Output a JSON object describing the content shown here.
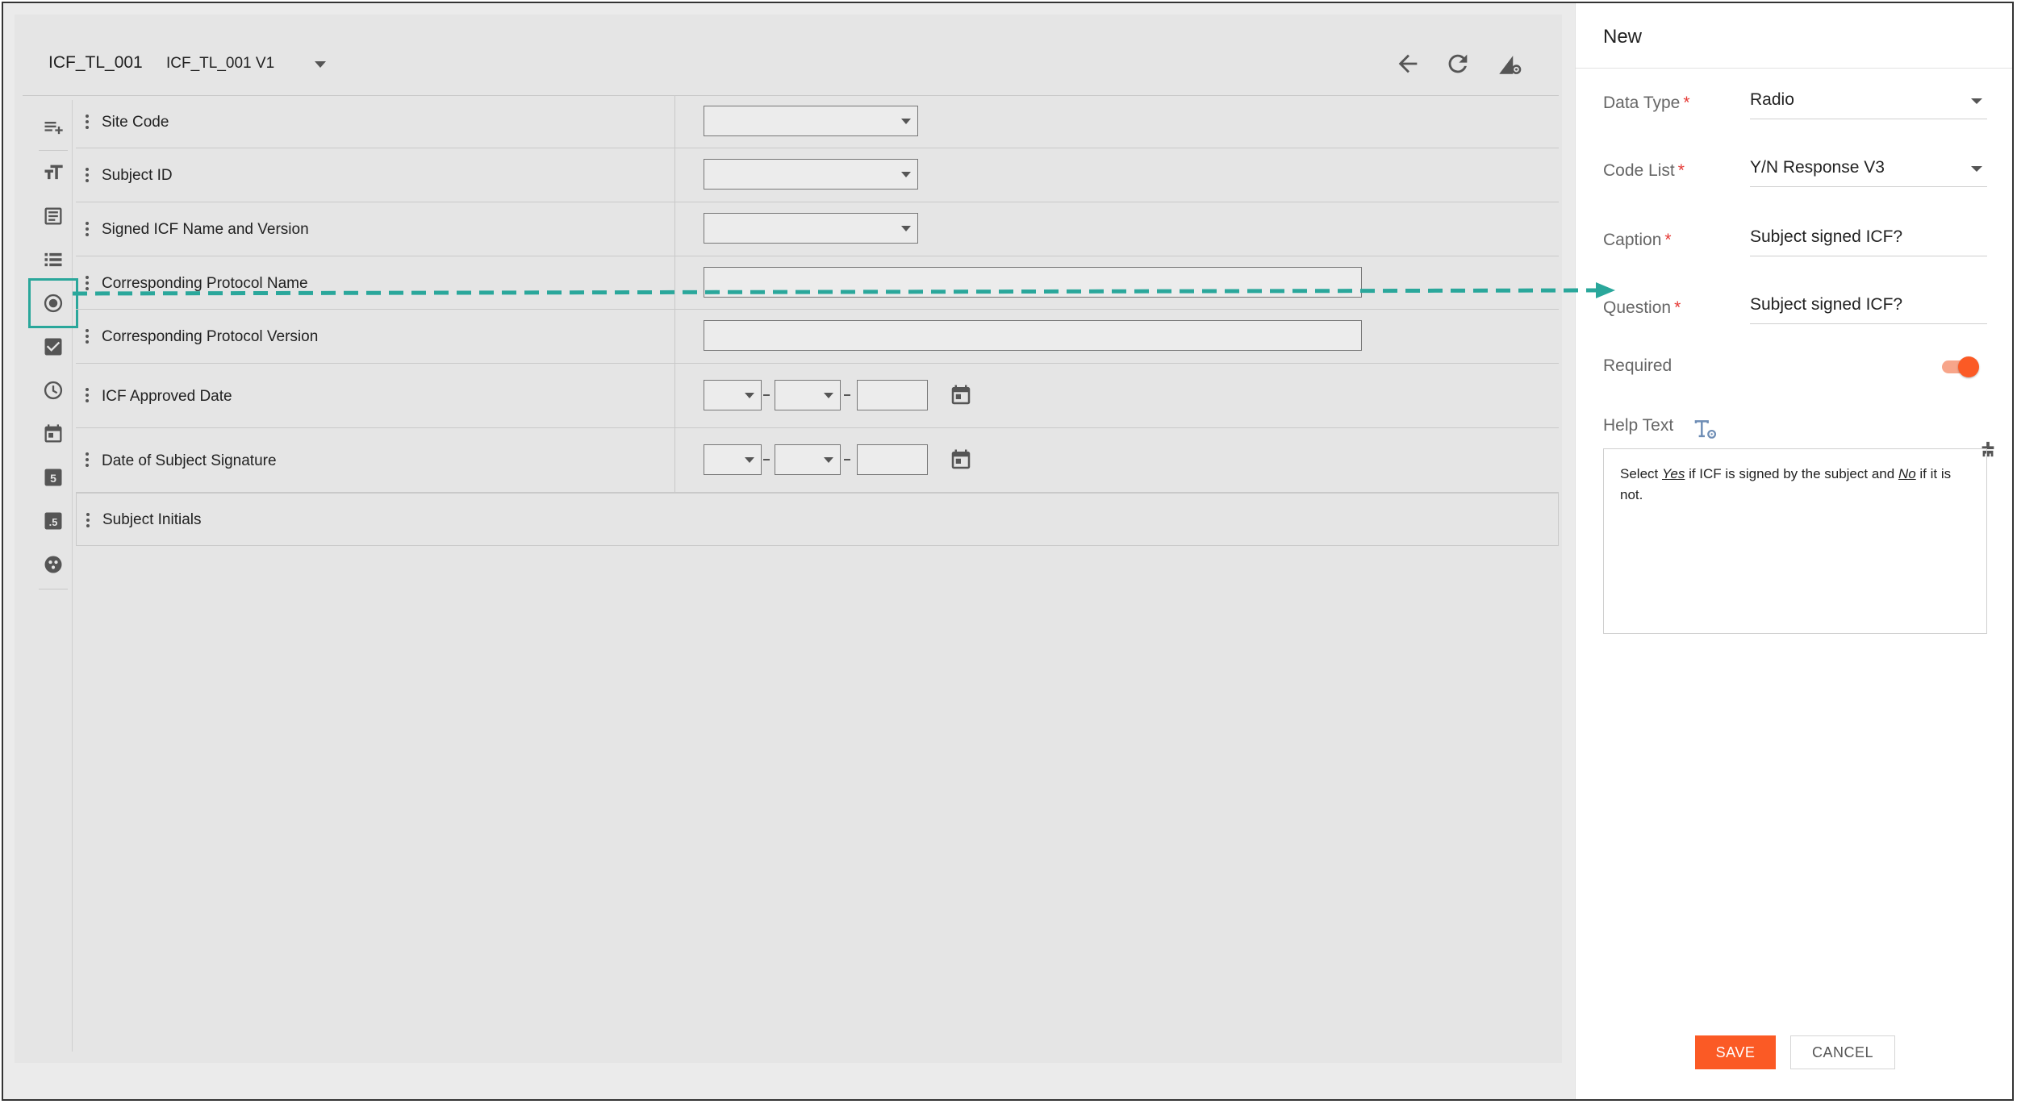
{
  "header": {
    "form_code": "ICF_TL_001",
    "form_version": "ICF_TL_001 V1"
  },
  "toolbar_icons": [
    "back-arrow-icon",
    "refresh-icon",
    "form-settings-icon"
  ],
  "toolbox": {
    "tools": [
      "add-row-icon",
      "text-size-icon",
      "text-block-icon",
      "list-icon",
      "radio-icon",
      "checkbox-icon",
      "time-icon",
      "date-icon",
      "number-icon",
      "decimal-icon",
      "lookup-icon"
    ],
    "selected": "radio-icon"
  },
  "rows": [
    {
      "label": "Site Code",
      "control": "select"
    },
    {
      "label": "Subject ID",
      "control": "select"
    },
    {
      "label": "Signed ICF Name and Version",
      "control": "select"
    },
    {
      "label": "Corresponding Protocol Name",
      "control": "text"
    },
    {
      "label": "Corresponding Protocol Version",
      "control": "text"
    },
    {
      "label": "ICF Approved Date",
      "control": "date"
    },
    {
      "label": "Date of Subject Signature",
      "control": "date"
    },
    {
      "label": "Subject Initials",
      "control": "none"
    }
  ],
  "panel": {
    "title": "New",
    "data_type": {
      "label": "Data Type",
      "value": "Radio"
    },
    "code_list": {
      "label": "Code List",
      "value": "Y/N Response V3"
    },
    "caption": {
      "label": "Caption",
      "value": "Subject signed ICF?"
    },
    "question": {
      "label": "Question",
      "value": "Subject signed ICF?"
    },
    "required": {
      "label": "Required",
      "on": true
    },
    "help_text": {
      "label": "Help Text",
      "prefix": "Select ",
      "yes": "Yes",
      "mid": " if ICF is signed by the subject and ",
      "no": "No",
      "suffix": " if it is not."
    },
    "required_marker": "*",
    "save_label": "SAVE",
    "cancel_label": "CANCEL"
  },
  "colors": {
    "accent": "#fb5a25",
    "drag_arrow": "#2aa79b",
    "required": "#e53935"
  }
}
